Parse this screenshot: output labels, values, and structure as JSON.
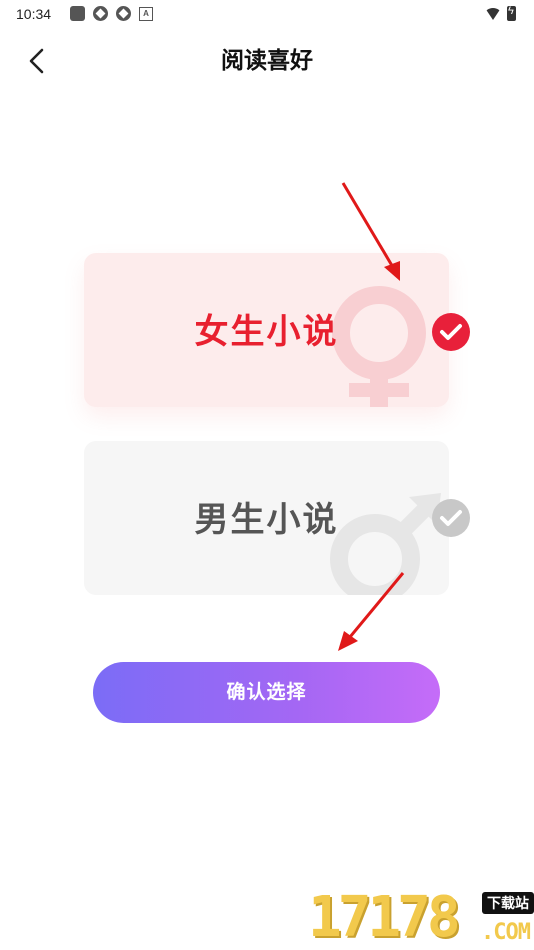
{
  "status_bar": {
    "time": "10:34"
  },
  "header": {
    "title": "阅读喜好"
  },
  "options": {
    "female": {
      "label": "女生小说",
      "selected": true
    },
    "male": {
      "label": "男生小说",
      "selected": false
    }
  },
  "confirm_label": "确认选择",
  "watermark": {
    "number": "17178",
    "tag": "下载站",
    "domain": ".COM"
  },
  "colors": {
    "accent_red": "#e8202f",
    "gradient_start": "#7b6cf6",
    "gradient_end": "#c56cf8"
  }
}
